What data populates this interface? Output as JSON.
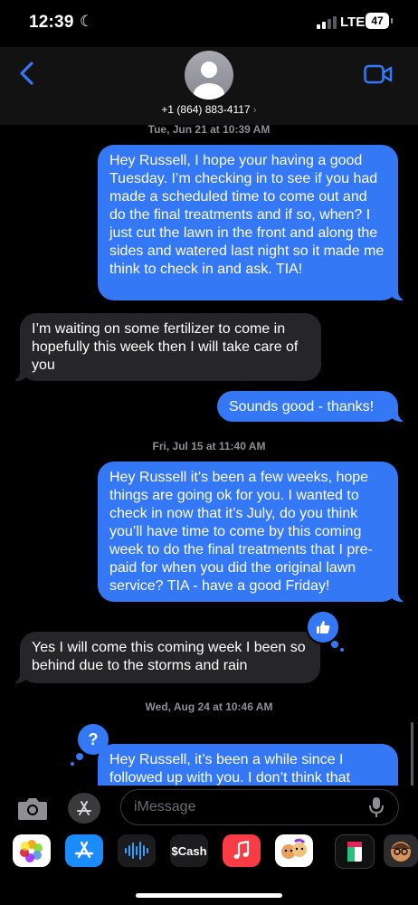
{
  "status_bar": {
    "time": "12:39",
    "network": "LTE",
    "battery": "47"
  },
  "header": {
    "contact": "+1 (864) 883-4117"
  },
  "thread": {
    "timestamps": [
      "Tue, Jun 21 at 10:39 AM",
      "Fri, Jul 15 at 11:40 AM",
      "Wed, Aug 24 at 10:46 AM"
    ],
    "messages": [
      {
        "direction": "sent",
        "text": "Hey Russell, I hope your having a good Tuesday. I’m checking in to see if you had made a scheduled time to come out and do the final treatments and if so, when? I just cut the lawn in the front and along the sides and watered last night so it made me think to check in and ask. TIA!"
      },
      {
        "direction": "received",
        "text": "I’m waiting on some fertilizer to come in hopefully this week then I will take care of you"
      },
      {
        "direction": "sent",
        "text": "Sounds good - thanks!"
      },
      {
        "direction": "sent",
        "text": "Hey Russell it’s been a few weeks, hope things are going ok for you. I wanted to check in now that it’s July, do you think you’ll have time to come by this coming week to do the final treatments that I pre-paid for when you did the original lawn service? TIA - have a good Friday!"
      },
      {
        "direction": "received",
        "text": "Yes I will come this coming week I been so behind due to the storms and rain"
      },
      {
        "direction": "sent",
        "text": "Hey Russell, it’s been a while since I followed up with you. I don’t think that"
      }
    ],
    "reactions": {
      "like": "thumbs-up-icon",
      "question": "?"
    }
  },
  "input_bar": {
    "placeholder": "iMessage"
  },
  "app_drawer": {
    "cash_label": "Cash",
    "cash_symbol": "$"
  },
  "colors": {
    "sent_bubble": "#3478f6",
    "received_bubble": "#262629",
    "accent": "#3478f6"
  }
}
